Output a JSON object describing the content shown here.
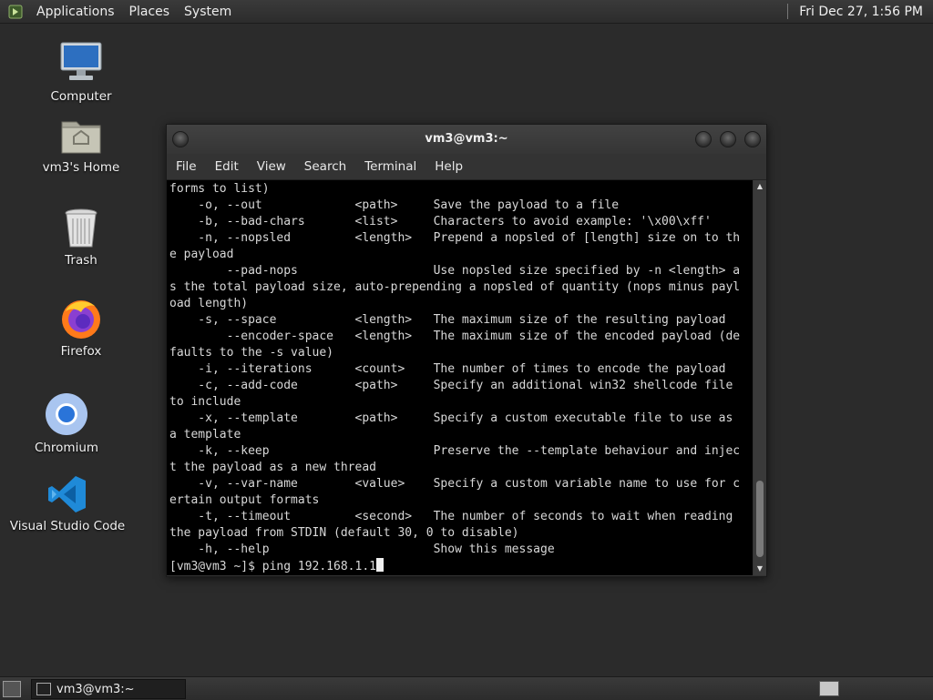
{
  "top_panel": {
    "menus": [
      "Applications",
      "Places",
      "System"
    ],
    "clock": "Fri Dec 27, 1:56 PM"
  },
  "desktop": {
    "icons": [
      {
        "label": "Computer",
        "icon": "computer-icon"
      },
      {
        "label": "vm3's Home",
        "icon": "home-folder-icon"
      },
      {
        "label": "Trash",
        "icon": "trash-icon"
      },
      {
        "label": "Firefox",
        "icon": "firefox-icon"
      },
      {
        "label": "Chromium",
        "icon": "chromium-icon"
      },
      {
        "label": "Visual Studio Code",
        "icon": "vscode-icon"
      }
    ]
  },
  "terminal": {
    "title": "vm3@vm3:~",
    "menu": [
      "File",
      "Edit",
      "View",
      "Search",
      "Terminal",
      "Help"
    ],
    "lines": [
      "forms to list)",
      "    -o, --out             <path>     Save the payload to a file",
      "    -b, --bad-chars       <list>     Characters to avoid example: '\\x00\\xff'",
      "    -n, --nopsled         <length>   Prepend a nopsled of [length] size on to th",
      "e payload",
      "        --pad-nops                   Use nopsled size specified by -n <length> a",
      "s the total payload size, auto-prepending a nopsled of quantity (nops minus payl",
      "oad length)",
      "    -s, --space           <length>   The maximum size of the resulting payload",
      "        --encoder-space   <length>   The maximum size of the encoded payload (de",
      "faults to the -s value)",
      "    -i, --iterations      <count>    The number of times to encode the payload",
      "    -c, --add-code        <path>     Specify an additional win32 shellcode file",
      "to include",
      "    -x, --template        <path>     Specify a custom executable file to use as",
      "a template",
      "    -k, --keep                       Preserve the --template behaviour and injec",
      "t the payload as a new thread",
      "    -v, --var-name        <value>    Specify a custom variable name to use for c",
      "ertain output formats",
      "    -t, --timeout         <second>   The number of seconds to wait when reading",
      "the payload from STDIN (default 30, 0 to disable)",
      "    -h, --help                       Show this message"
    ],
    "prompt": "[vm3@vm3 ~]$ ping 192.168.1.1"
  },
  "taskbar": {
    "task_label": "vm3@vm3:~"
  }
}
